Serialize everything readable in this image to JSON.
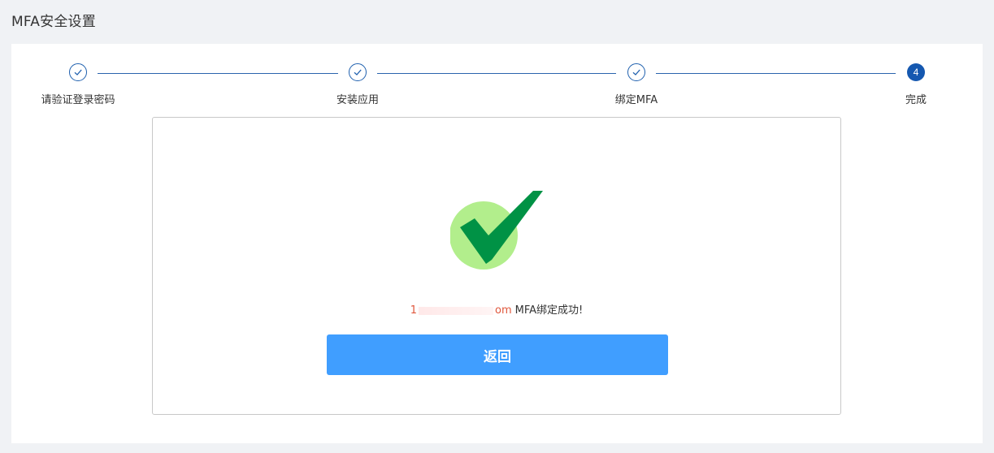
{
  "page": {
    "title": "MFA安全设置"
  },
  "steps": [
    {
      "label": "请验证登录密码",
      "status": "done"
    },
    {
      "label": "安装应用",
      "status": "done"
    },
    {
      "label": "绑定MFA",
      "status": "done"
    },
    {
      "label": "完成",
      "status": "active",
      "number": "4"
    }
  ],
  "result": {
    "account_prefix": "1",
    "account_suffix": "om",
    "message": "MFA绑定成功!",
    "back_label": "返回",
    "colors": {
      "check_circle": "#b2ee8c",
      "check_mark": "#009245",
      "button": "#409eff",
      "step_active": "#1558b0"
    }
  }
}
